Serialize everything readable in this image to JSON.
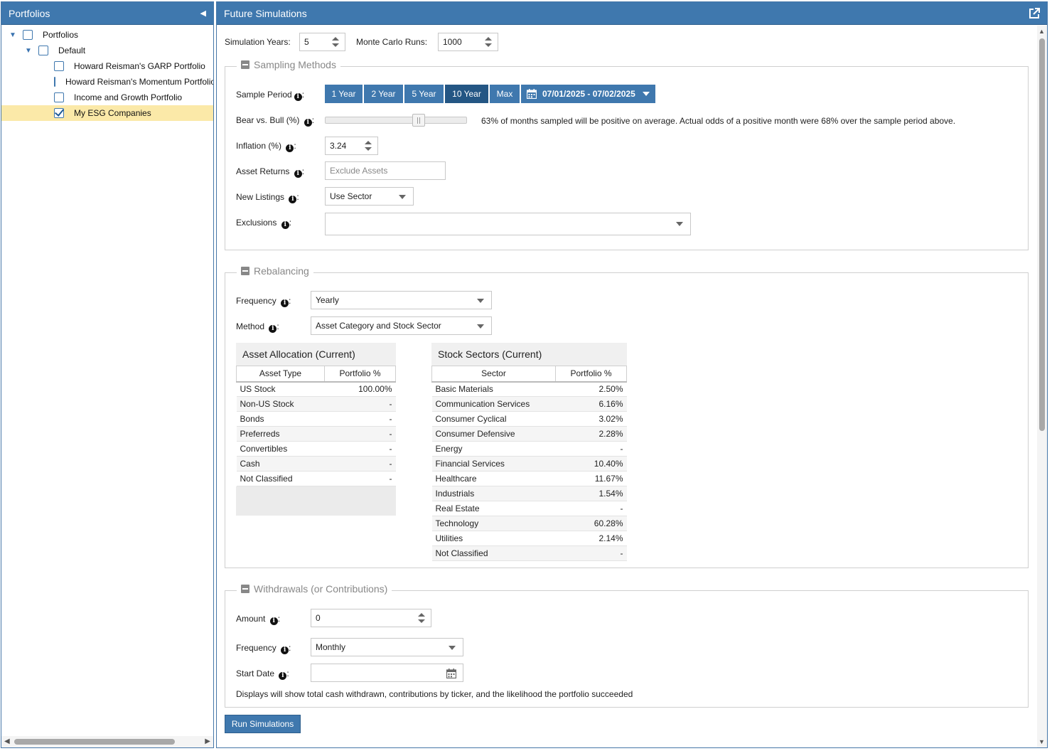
{
  "left_panel": {
    "title": "Portfolios",
    "tree": {
      "root_label": "Portfolios",
      "group_label": "Default",
      "items": [
        {
          "label": "Howard Reisman's GARP Portfolio",
          "checked": false
        },
        {
          "label": "Howard Reisman's Momentum Portfolio",
          "checked": false
        },
        {
          "label": "Income and Growth Portfolio",
          "checked": false
        },
        {
          "label": "My ESG Companies",
          "checked": true
        }
      ]
    }
  },
  "main": {
    "title": "Future Simulations",
    "simulation_years": {
      "label": "Simulation Years:",
      "value": "5"
    },
    "monte_carlo": {
      "label": "Monte Carlo Runs:",
      "value": "1000"
    },
    "sampling": {
      "legend": "Sampling Methods",
      "sample_period_label": "Sample Period",
      "periods": [
        "1 Year",
        "2 Year",
        "5 Year",
        "10 Year",
        "Max"
      ],
      "active_period": "10 Year",
      "date_range": "07/01/2025 - 07/02/2025",
      "bear_bull_label": "Bear vs. Bull (%)",
      "bear_bull_value": 0.66,
      "bear_bull_text": "63% of months sampled will be positive on average. Actual odds of a positive month were 68% over the sample period above.",
      "inflation_label": "Inflation (%)",
      "inflation_value": "3.24",
      "asset_returns_label": "Asset Returns",
      "asset_returns_placeholder": "Exclude Assets",
      "new_listings_label": "New Listings",
      "new_listings_value": "Use Sector",
      "exclusions_label": "Exclusions",
      "exclusions_value": ""
    },
    "rebalancing": {
      "legend": "Rebalancing",
      "frequency_label": "Frequency",
      "frequency_value": "Yearly",
      "method_label": "Method",
      "method_value": "Asset Category and Stock Sector",
      "asset_allocation": {
        "title": "Asset Allocation (Current)",
        "headers": [
          "Asset Type",
          "Portfolio %"
        ],
        "rows": [
          [
            "US Stock",
            "100.00%"
          ],
          [
            "Non-US Stock",
            "-"
          ],
          [
            "Bonds",
            "-"
          ],
          [
            "Preferreds",
            "-"
          ],
          [
            "Convertibles",
            "-"
          ],
          [
            "Cash",
            "-"
          ],
          [
            "Not Classified",
            "-"
          ]
        ]
      },
      "stock_sectors": {
        "title": "Stock Sectors (Current)",
        "headers": [
          "Sector",
          "Portfolio %"
        ],
        "rows": [
          [
            "Basic Materials",
            "2.50%"
          ],
          [
            "Communication Services",
            "6.16%"
          ],
          [
            "Consumer Cyclical",
            "3.02%"
          ],
          [
            "Consumer Defensive",
            "2.28%"
          ],
          [
            "Energy",
            "-"
          ],
          [
            "Financial Services",
            "10.40%"
          ],
          [
            "Healthcare",
            "11.67%"
          ],
          [
            "Industrials",
            "1.54%"
          ],
          [
            "Real Estate",
            "-"
          ],
          [
            "Technology",
            "60.28%"
          ],
          [
            "Utilities",
            "2.14%"
          ],
          [
            "Not Classified",
            "-"
          ]
        ]
      }
    },
    "withdrawals": {
      "legend": "Withdrawals (or Contributions)",
      "amount_label": "Amount",
      "amount_value": "0",
      "frequency_label": "Frequency",
      "frequency_value": "Monthly",
      "start_date_label": "Start Date",
      "start_date_value": "",
      "note": "Displays will show total cash withdrawn, contributions by ticker, and the likelihood the portfolio succeeded"
    },
    "run_button": "Run Simulations"
  },
  "colors": {
    "header_blue": "#3f78ae",
    "active_blue": "#245684",
    "selection_yellow": "#fbe9a8"
  }
}
